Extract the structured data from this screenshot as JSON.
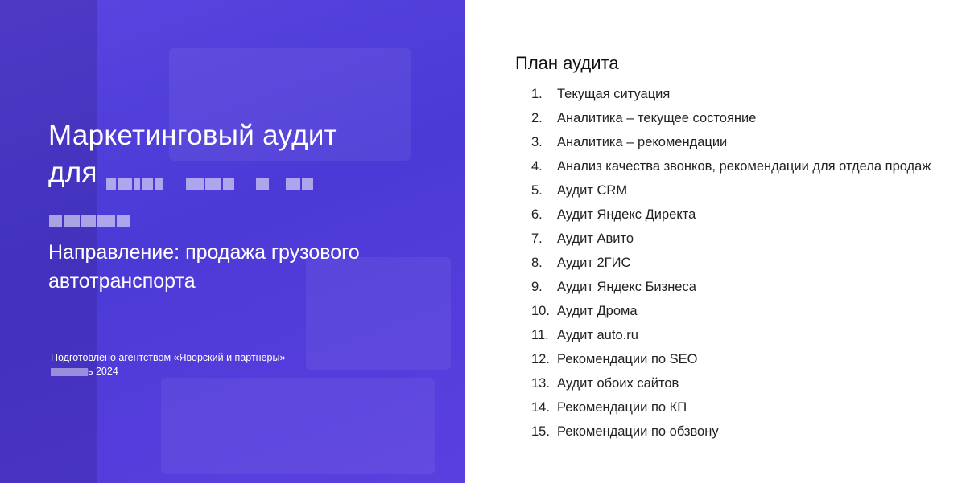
{
  "left_panel": {
    "title_line1": "Маркетинговый аудит",
    "title_for": "для",
    "direction": "Направление: продажа грузового автотранспорта",
    "prepared_by": "Подготовлено агентством «Яворский и партнеры»",
    "date_suffix": "ь 2024"
  },
  "plan": {
    "title": "План аудита",
    "items": [
      {
        "num": "1.",
        "text": "Текущая ситуация"
      },
      {
        "num": "2.",
        "text": "Аналитика – текущее состояние"
      },
      {
        "num": "3.",
        "text": "Аналитика – рекомендации"
      },
      {
        "num": "4.",
        "text": "Анализ качества звонков, рекомендации для отдела продаж"
      },
      {
        "num": "5.",
        "text": "Аудит CRM"
      },
      {
        "num": "6.",
        "text": "Аудит Яндекс Директа"
      },
      {
        "num": "7.",
        "text": "Аудит Авито"
      },
      {
        "num": "8.",
        "text": "Аудит 2ГИС"
      },
      {
        "num": "9.",
        "text": "Аудит Яндекс Бизнеса"
      },
      {
        "num": "10.",
        "text": "Аудит Дрома"
      },
      {
        "num": "11.",
        "text": "Аудит auto.ru"
      },
      {
        "num": "12.",
        "text": "Рекомендации по SEO"
      },
      {
        "num": "13.",
        "text": "Аудит обоих сайтов"
      },
      {
        "num": "14.",
        "text": "Рекомендации по КП"
      },
      {
        "num": "15.",
        "text": "Рекомендации по обзвону"
      }
    ]
  },
  "colors": {
    "panel_purple": "#5a45e0",
    "text_dark": "#222222"
  }
}
